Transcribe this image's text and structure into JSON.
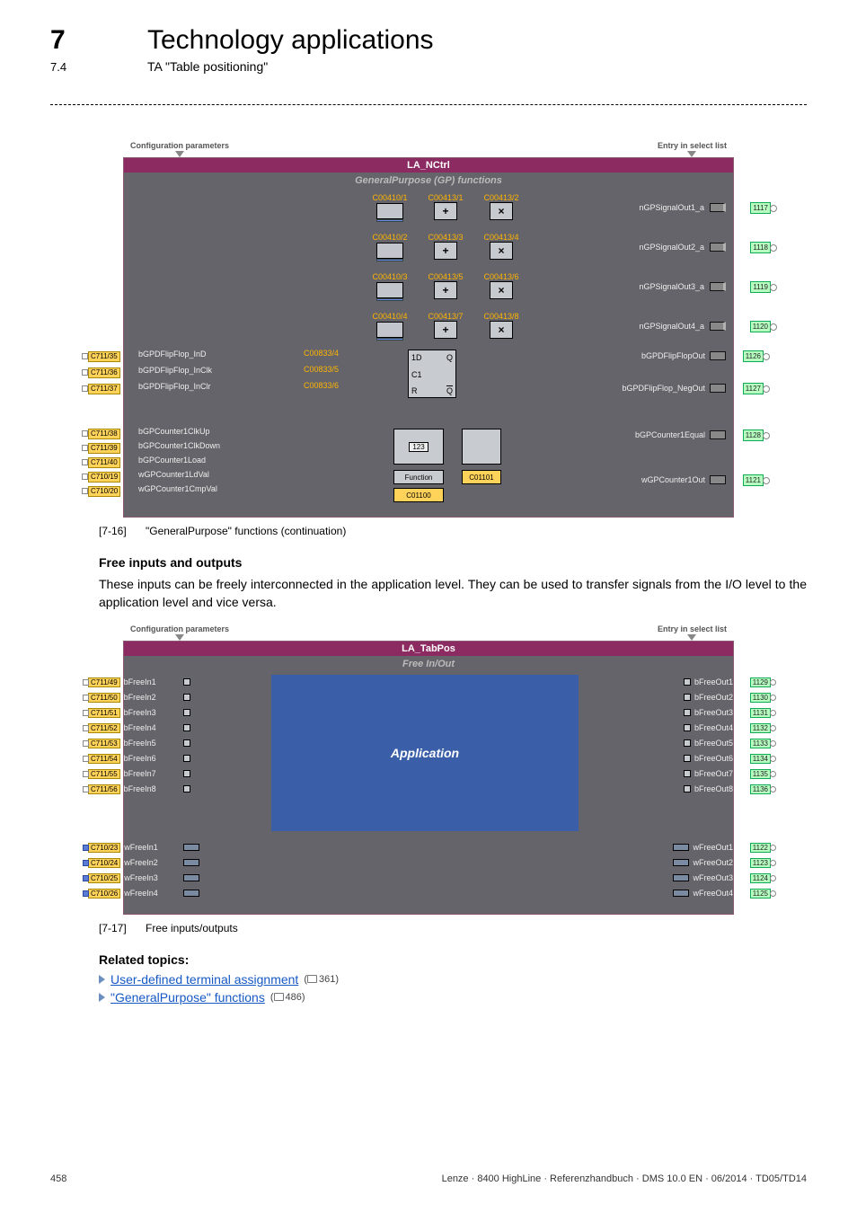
{
  "header": {
    "chapter_num": "7",
    "chapter_title": "Technology applications",
    "section_num": "7.4",
    "section_title": "TA \"Table positioning\""
  },
  "diagram1": {
    "top_left_label": "Configuration parameters",
    "top_right_label": "Entry in select list",
    "titlebar": "LA_NCtrl",
    "subtitle": "GeneralPurpose (GP) functions",
    "gp_rows": [
      {
        "c_a": "C00410/1",
        "c_b": "C00413/1",
        "c_c": "C00413/2",
        "out": "nGPSignalOut1_a",
        "tag": "1117"
      },
      {
        "c_a": "C00410/2",
        "c_b": "C00413/3",
        "c_c": "C00413/4",
        "out": "nGPSignalOut2_a",
        "tag": "1118"
      },
      {
        "c_a": "C00410/3",
        "c_b": "C00413/5",
        "c_c": "C00413/6",
        "out": "nGPSignalOut3_a",
        "tag": "1119"
      },
      {
        "c_a": "C00410/4",
        "c_b": "C00413/7",
        "c_c": "C00413/8",
        "out": "nGPSignalOut4_a",
        "tag": "1120"
      }
    ],
    "ff": {
      "in_tags": [
        "C711/35",
        "C711/36",
        "C711/37"
      ],
      "in_labels": [
        "bGPDFlipFlop_InD",
        "bGPDFlipFlop_InClk",
        "bGPDFlipFlop_InClr"
      ],
      "code_labels": [
        "C00833/4",
        "C00833/5",
        "C00833/6"
      ],
      "box": {
        "d": "1D",
        "q": "Q",
        "c": "C1",
        "r": "R",
        "qn": "Q"
      },
      "outs": [
        {
          "label": "bGPDFlipFlopOut",
          "tag": "1126"
        },
        {
          "label": "bGPDFlipFlop_NegOut",
          "tag": "1127"
        }
      ]
    },
    "counter": {
      "in_tags": [
        "C711/38",
        "C711/39",
        "C711/40",
        "C710/19",
        "C710/20"
      ],
      "in_labels": [
        "bGPCounter1ClkUp",
        "bGPCounter1ClkDown",
        "bGPCounter1Load",
        "wGPCounter1LdVal",
        "wGPCounter1CmpVal"
      ],
      "box_text": "123",
      "fn_label": "Function",
      "c1": "C01100",
      "c2": "C01101",
      "outs": [
        {
          "label": "bGPCounter1Equal",
          "tag": "1128"
        },
        {
          "label": "wGPCounter1Out",
          "tag": "1121"
        }
      ]
    }
  },
  "caption1": {
    "idx": "[7-16]",
    "text": "\"GeneralPurpose\" functions (continuation)"
  },
  "body": {
    "h_free": "Free inputs and outputs",
    "p_free": "These inputs can be freely interconnected in the application level. They can be used to transfer signals from the I/O level to the application level and vice versa.",
    "h_related": "Related topics:",
    "link1": "User-defined terminal assignment",
    "ref1": "361",
    "link2": "\"GeneralPurpose\" functions",
    "ref2": "486"
  },
  "diagram2": {
    "top_left_label": "Configuration parameters",
    "top_right_label": "Entry in select list",
    "titlebar": "LA_TabPos",
    "subtitle": "Free In/Out",
    "app_label": "Application",
    "b_in": [
      {
        "tag": "C711/49",
        "sig": "bFreeIn1"
      },
      {
        "tag": "C711/50",
        "sig": "bFreeIn2"
      },
      {
        "tag": "C711/51",
        "sig": "bFreeIn3"
      },
      {
        "tag": "C711/52",
        "sig": "bFreeIn4"
      },
      {
        "tag": "C711/53",
        "sig": "bFreeIn5"
      },
      {
        "tag": "C711/54",
        "sig": "bFreeIn6"
      },
      {
        "tag": "C711/55",
        "sig": "bFreeIn7"
      },
      {
        "tag": "C711/56",
        "sig": "bFreeIn8"
      }
    ],
    "w_in": [
      {
        "tag": "C710/23",
        "sig": "wFreeIn1"
      },
      {
        "tag": "C710/24",
        "sig": "wFreeIn2"
      },
      {
        "tag": "C710/25",
        "sig": "wFreeIn3"
      },
      {
        "tag": "C710/26",
        "sig": "wFreeIn4"
      }
    ],
    "b_out": [
      {
        "sig": "bFreeOut1",
        "tag": "1129"
      },
      {
        "sig": "bFreeOut2",
        "tag": "1130"
      },
      {
        "sig": "bFreeOut3",
        "tag": "1131"
      },
      {
        "sig": "bFreeOut4",
        "tag": "1132"
      },
      {
        "sig": "bFreeOut5",
        "tag": "1133"
      },
      {
        "sig": "bFreeOut6",
        "tag": "1134"
      },
      {
        "sig": "bFreeOut7",
        "tag": "1135"
      },
      {
        "sig": "bFreeOut8",
        "tag": "1136"
      }
    ],
    "w_out": [
      {
        "sig": "wFreeOut1",
        "tag": "1122"
      },
      {
        "sig": "wFreeOut2",
        "tag": "1123"
      },
      {
        "sig": "wFreeOut3",
        "tag": "1124"
      },
      {
        "sig": "wFreeOut4",
        "tag": "1125"
      }
    ]
  },
  "caption2": {
    "idx": "[7-17]",
    "text": "Free inputs/outputs"
  },
  "footer": {
    "page": "458",
    "doc": "Lenze · 8400 HighLine · Referenzhandbuch · DMS 10.0 EN · 06/2014 · TD05/TD14"
  }
}
